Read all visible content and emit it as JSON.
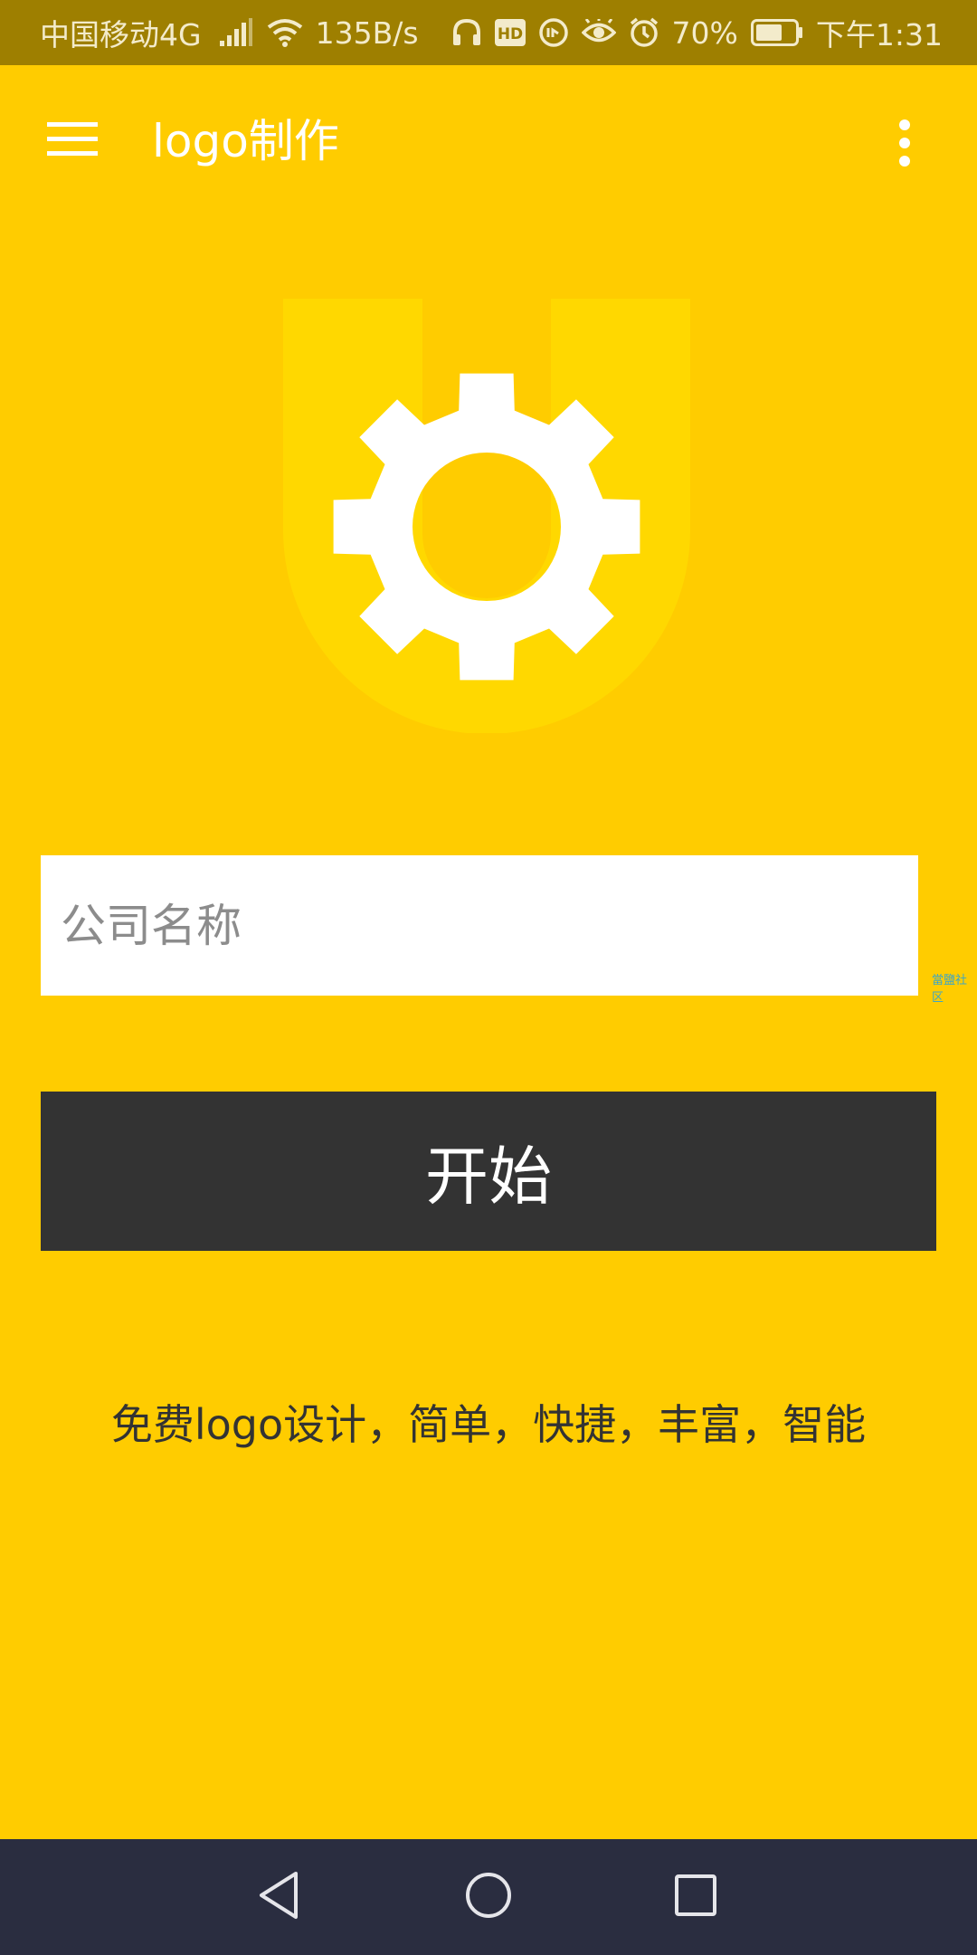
{
  "status_bar": {
    "carrier": "中国移动4G",
    "net_type": "4G",
    "speed": "135B/s",
    "battery": "70%",
    "time": "下午1:31",
    "icons": [
      "signal-icon",
      "wifi-icon",
      "headphones-icon",
      "hd-icon",
      "data-saver-icon",
      "eye-icon",
      "alarm-icon",
      "battery-icon"
    ],
    "battery_level": 0.7
  },
  "app_bar": {
    "title": "logo制作",
    "menu_icon": "menu-icon",
    "overflow_icon": "more-vert-icon"
  },
  "logo": {
    "icon": "gear-icon"
  },
  "form": {
    "company_placeholder": "公司名称",
    "company_value": "",
    "start_label": "开始"
  },
  "tagline": "免费logo设计，简单，快捷，丰富，智能",
  "watermark": "當鹽社区",
  "nav_bar": {
    "back_icon": "back-icon",
    "home_icon": "home-icon",
    "recents_icon": "recents-icon"
  },
  "colors": {
    "background": "#FFCC00",
    "status_bar": "#9E7F00",
    "button": "#333333",
    "nav_bar": "#2A2D40",
    "logo_u": "#FFD800"
  }
}
